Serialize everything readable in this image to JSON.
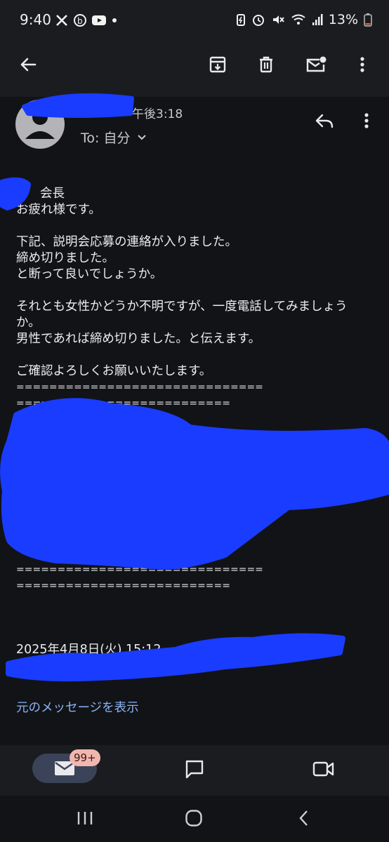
{
  "status_bar": {
    "time": "9:40",
    "battery_text": "13%"
  },
  "message": {
    "time": "午後3:18",
    "recipient_prefix": "To: 自分",
    "body_lines": [
      "会長",
      "お疲れ様です。",
      "下記、説明会応募の連絡が入りました。",
      "締め切りました。",
      "と断って良いでしょうか。",
      "それとも女性かどうか不明ですが、一度電話してみましょう",
      "か。",
      "男性であれば締め切りました。と伝えます。",
      "ご確認よろしくお願いいたします。",
      "==============================",
      "=========================="
    ],
    "separator_bottom_1": "==============================",
    "separator_bottom_2": "==========================",
    "quoted_date": "2025年4月8日(火) 15:12",
    "show_original": "元のメッセージを表示"
  },
  "bottom_nav": {
    "badge": "99+"
  },
  "colors": {
    "background": "#121317",
    "bar": "#1b1c20",
    "link": "#8ab4f8",
    "redaction": "#1a3cff",
    "badge_bg": "#f1b7ae"
  }
}
